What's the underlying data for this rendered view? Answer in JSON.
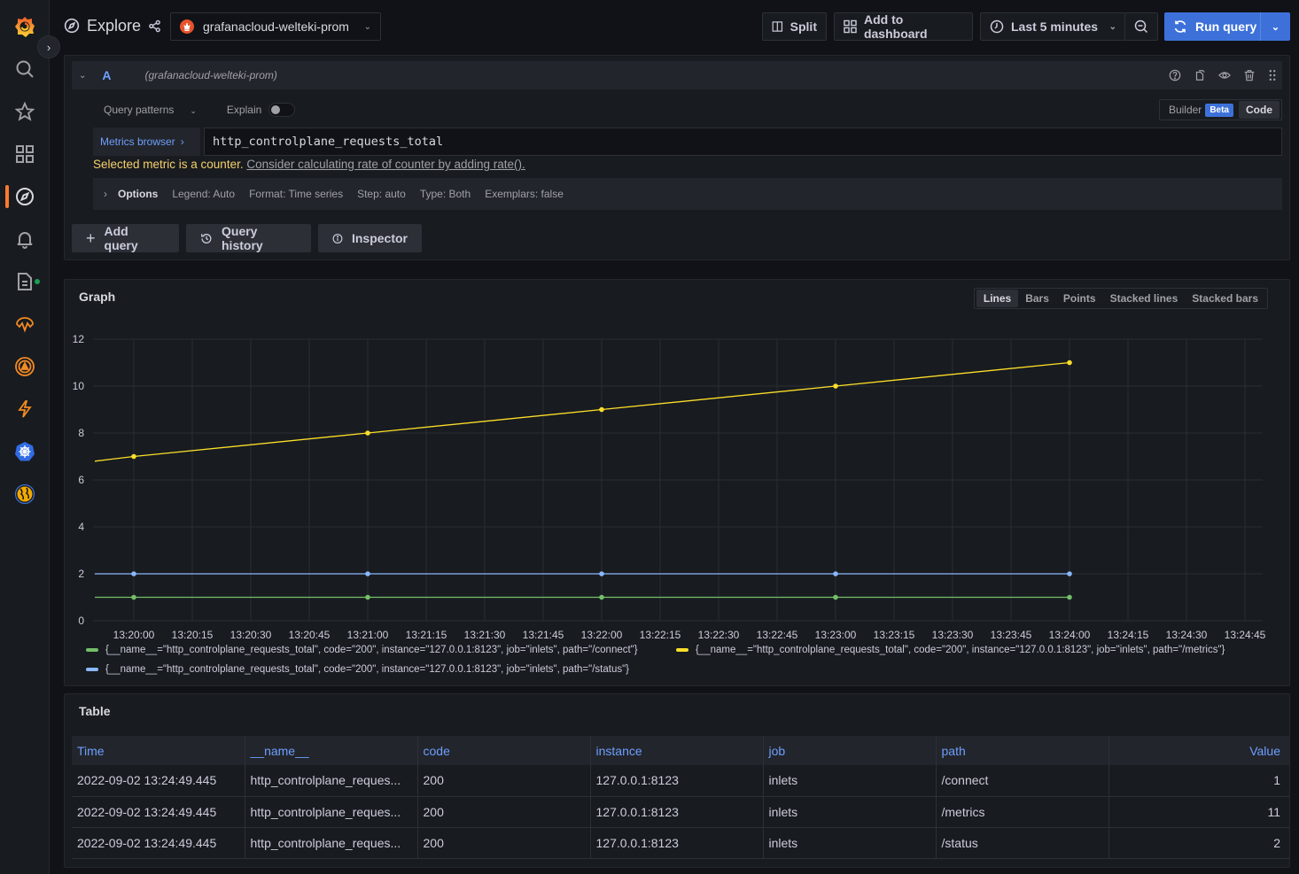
{
  "app": {
    "title": "Explore"
  },
  "sidebar": {
    "items": [
      {
        "name": "search",
        "label": "Search"
      },
      {
        "name": "starred",
        "label": "Starred"
      },
      {
        "name": "dashboards",
        "label": "Dashboards"
      },
      {
        "name": "explore",
        "label": "Explore",
        "active": true
      },
      {
        "name": "alerting",
        "label": "Alerting"
      },
      {
        "name": "logs",
        "label": "Logs"
      },
      {
        "name": "ml",
        "label": "Machine Learning"
      },
      {
        "name": "oncall",
        "label": "OnCall"
      },
      {
        "name": "incident",
        "label": "Incident"
      },
      {
        "name": "kubernetes",
        "label": "Kubernetes"
      },
      {
        "name": "synthetic",
        "label": "Synthetic Monitoring"
      }
    ]
  },
  "toolbar": {
    "datasource": "grafanacloud-welteki-prom",
    "split": "Split",
    "add_to_dashboard": "Add to dashboard",
    "time_range": "Last 5 minutes",
    "run_query": "Run query"
  },
  "query": {
    "ref": "A",
    "datasource_hint": "(grafanacloud-welteki-prom)",
    "query_patterns": "Query patterns",
    "explain": "Explain",
    "explain_on": false,
    "builder": "Builder",
    "beta": "Beta",
    "code": "Code",
    "metrics_browser": "Metrics browser",
    "expr": "http_controlplane_requests_total",
    "warning_prefix": "Selected metric is a counter.",
    "warning_link": "Consider calculating rate of counter by adding rate().",
    "options": {
      "label": "Options",
      "legend": "Legend: Auto",
      "format": "Format: Time series",
      "step": "Step: auto",
      "type": "Type: Both",
      "exemplars": "Exemplars: false"
    },
    "add_query": "Add query",
    "query_history": "Query history",
    "inspector": "Inspector"
  },
  "graph": {
    "title": "Graph",
    "modes": [
      "Lines",
      "Bars",
      "Points",
      "Stacked lines",
      "Stacked bars"
    ],
    "active_mode": "Lines"
  },
  "chart_data": {
    "type": "line",
    "title": "Graph",
    "x": [
      "13:20:00",
      "13:21:00",
      "13:22:00",
      "13:23:00",
      "13:24:00"
    ],
    "x_ticks": [
      "13:20:00",
      "13:20:15",
      "13:20:30",
      "13:20:45",
      "13:21:00",
      "13:21:15",
      "13:21:30",
      "13:21:45",
      "13:22:00",
      "13:22:15",
      "13:22:30",
      "13:22:45",
      "13:23:00",
      "13:23:15",
      "13:23:30",
      "13:23:45",
      "13:24:00",
      "13:24:15",
      "13:24:30",
      "13:24:45"
    ],
    "y_ticks": [
      0,
      2,
      4,
      6,
      8,
      10,
      12
    ],
    "ylim": [
      0,
      12
    ],
    "grid": true,
    "legend_position": "bottom",
    "series": [
      {
        "name": "{__name__=\"http_controlplane_requests_total\", code=\"200\", instance=\"127.0.0.1:8123\", job=\"inlets\", path=\"/connect\"}",
        "color": "#73bf69",
        "values": [
          1,
          1,
          1,
          1,
          1
        ],
        "start_value": 1
      },
      {
        "name": "{__name__=\"http_controlplane_requests_total\", code=\"200\", instance=\"127.0.0.1:8123\", job=\"inlets\", path=\"/metrics\"}",
        "color": "#fade2a",
        "values": [
          7,
          8,
          9,
          10,
          11
        ],
        "start_value": 6.8
      },
      {
        "name": "{__name__=\"http_controlplane_requests_total\", code=\"200\", instance=\"127.0.0.1:8123\", job=\"inlets\", path=\"/status\"}",
        "color": "#8ab8ff",
        "values": [
          2,
          2,
          2,
          2,
          2
        ],
        "start_value": 2
      }
    ]
  },
  "table": {
    "title": "Table",
    "columns": [
      "Time",
      "__name__",
      "code",
      "instance",
      "job",
      "path",
      "Value"
    ],
    "rows": [
      [
        "2022-09-02 13:24:49.445",
        "http_controlplane_reques...",
        "200",
        "127.0.0.1:8123",
        "inlets",
        "/connect",
        "1"
      ],
      [
        "2022-09-02 13:24:49.445",
        "http_controlplane_reques...",
        "200",
        "127.0.0.1:8123",
        "inlets",
        "/metrics",
        "11"
      ],
      [
        "2022-09-02 13:24:49.445",
        "http_controlplane_reques...",
        "200",
        "127.0.0.1:8123",
        "inlets",
        "/status",
        "2"
      ]
    ]
  }
}
